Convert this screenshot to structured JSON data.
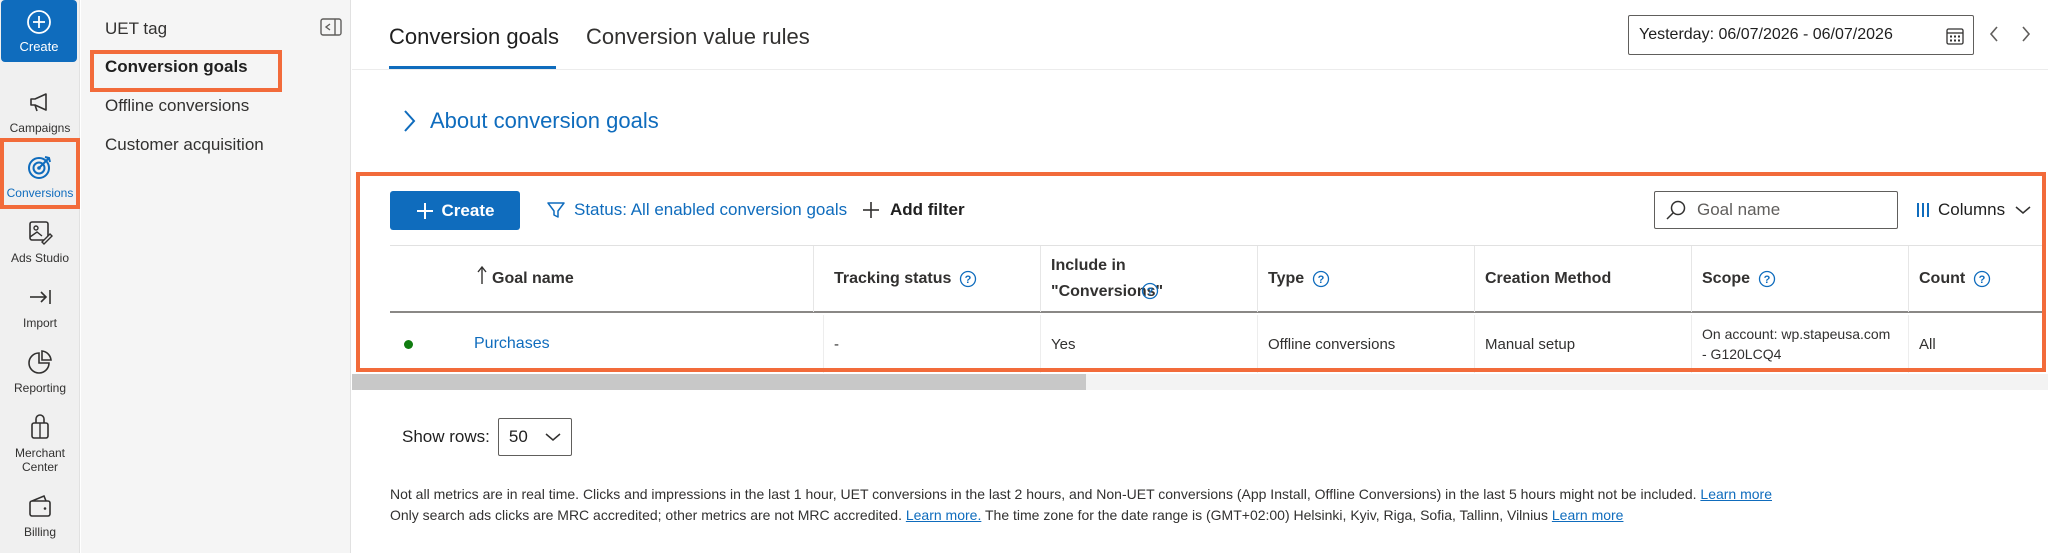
{
  "rail": {
    "create": "Create",
    "items": [
      {
        "label": "Campaigns",
        "icon": "megaphone-icon"
      },
      {
        "label": "Conversions",
        "icon": "target-icon"
      },
      {
        "label": "Ads Studio",
        "icon": "image-edit-icon"
      },
      {
        "label": "Import",
        "icon": "import-arrow-icon"
      },
      {
        "label": "Reporting",
        "icon": "pie-chart-icon"
      },
      {
        "label": "Merchant Center",
        "icon": "shopping-bag-icon"
      },
      {
        "label": "Billing",
        "icon": "wallet-icon"
      }
    ]
  },
  "subnav": {
    "items": [
      "UET tag",
      "Conversion goals",
      "Offline conversions",
      "Customer acquisition"
    ],
    "active": "Conversion goals"
  },
  "tabs": [
    "Conversion goals",
    "Conversion value rules"
  ],
  "date_range": "Yesterday: 06/07/2026 - 06/07/2026",
  "about_link": "About conversion goals",
  "toolbar": {
    "create_label": "Create",
    "status_filter": "Status: All enabled conversion goals",
    "add_filter": "Add filter",
    "search_placeholder": "Goal name",
    "columns_label": "Columns"
  },
  "table": {
    "columns": [
      "Goal name",
      "Tracking status",
      "Include in \"Conversions\"",
      "Type",
      "Creation Method",
      "Scope",
      "Count"
    ],
    "rows": [
      {
        "status_color": "#107c10",
        "goal_name": "Purchases",
        "tracking_status": "-",
        "include": "Yes",
        "type": "Offline conversions",
        "creation_method": "Manual setup",
        "scope_line1": "On account: wp.stapeusa.com",
        "scope_line2": "- G120LCQ4",
        "count": "All"
      }
    ]
  },
  "show_rows": {
    "label": "Show rows:",
    "value": "50"
  },
  "footnote": {
    "line1": "Not all metrics are in real time. Clicks and impressions in the last 1 hour, UET conversions in the last 2 hours, and Non-UET conversions (App Install, Offline Conversions) in the last 5 hours might not be included.",
    "line1_link": "Learn more",
    "line2_a": "Only search ads clicks are MRC accredited; other metrics are not MRC accredited.",
    "line2_link1": "Learn more.",
    "line2_b": "The time zone for the date range is (GMT+02:00) Helsinki, Kyiv, Riga, Sofia, Tallinn, Vilnius",
    "line2_link2": "Learn more"
  },
  "colors": {
    "accent": "#0f6cbd",
    "highlight": "#f26b3a",
    "status_enabled": "#107c10"
  }
}
